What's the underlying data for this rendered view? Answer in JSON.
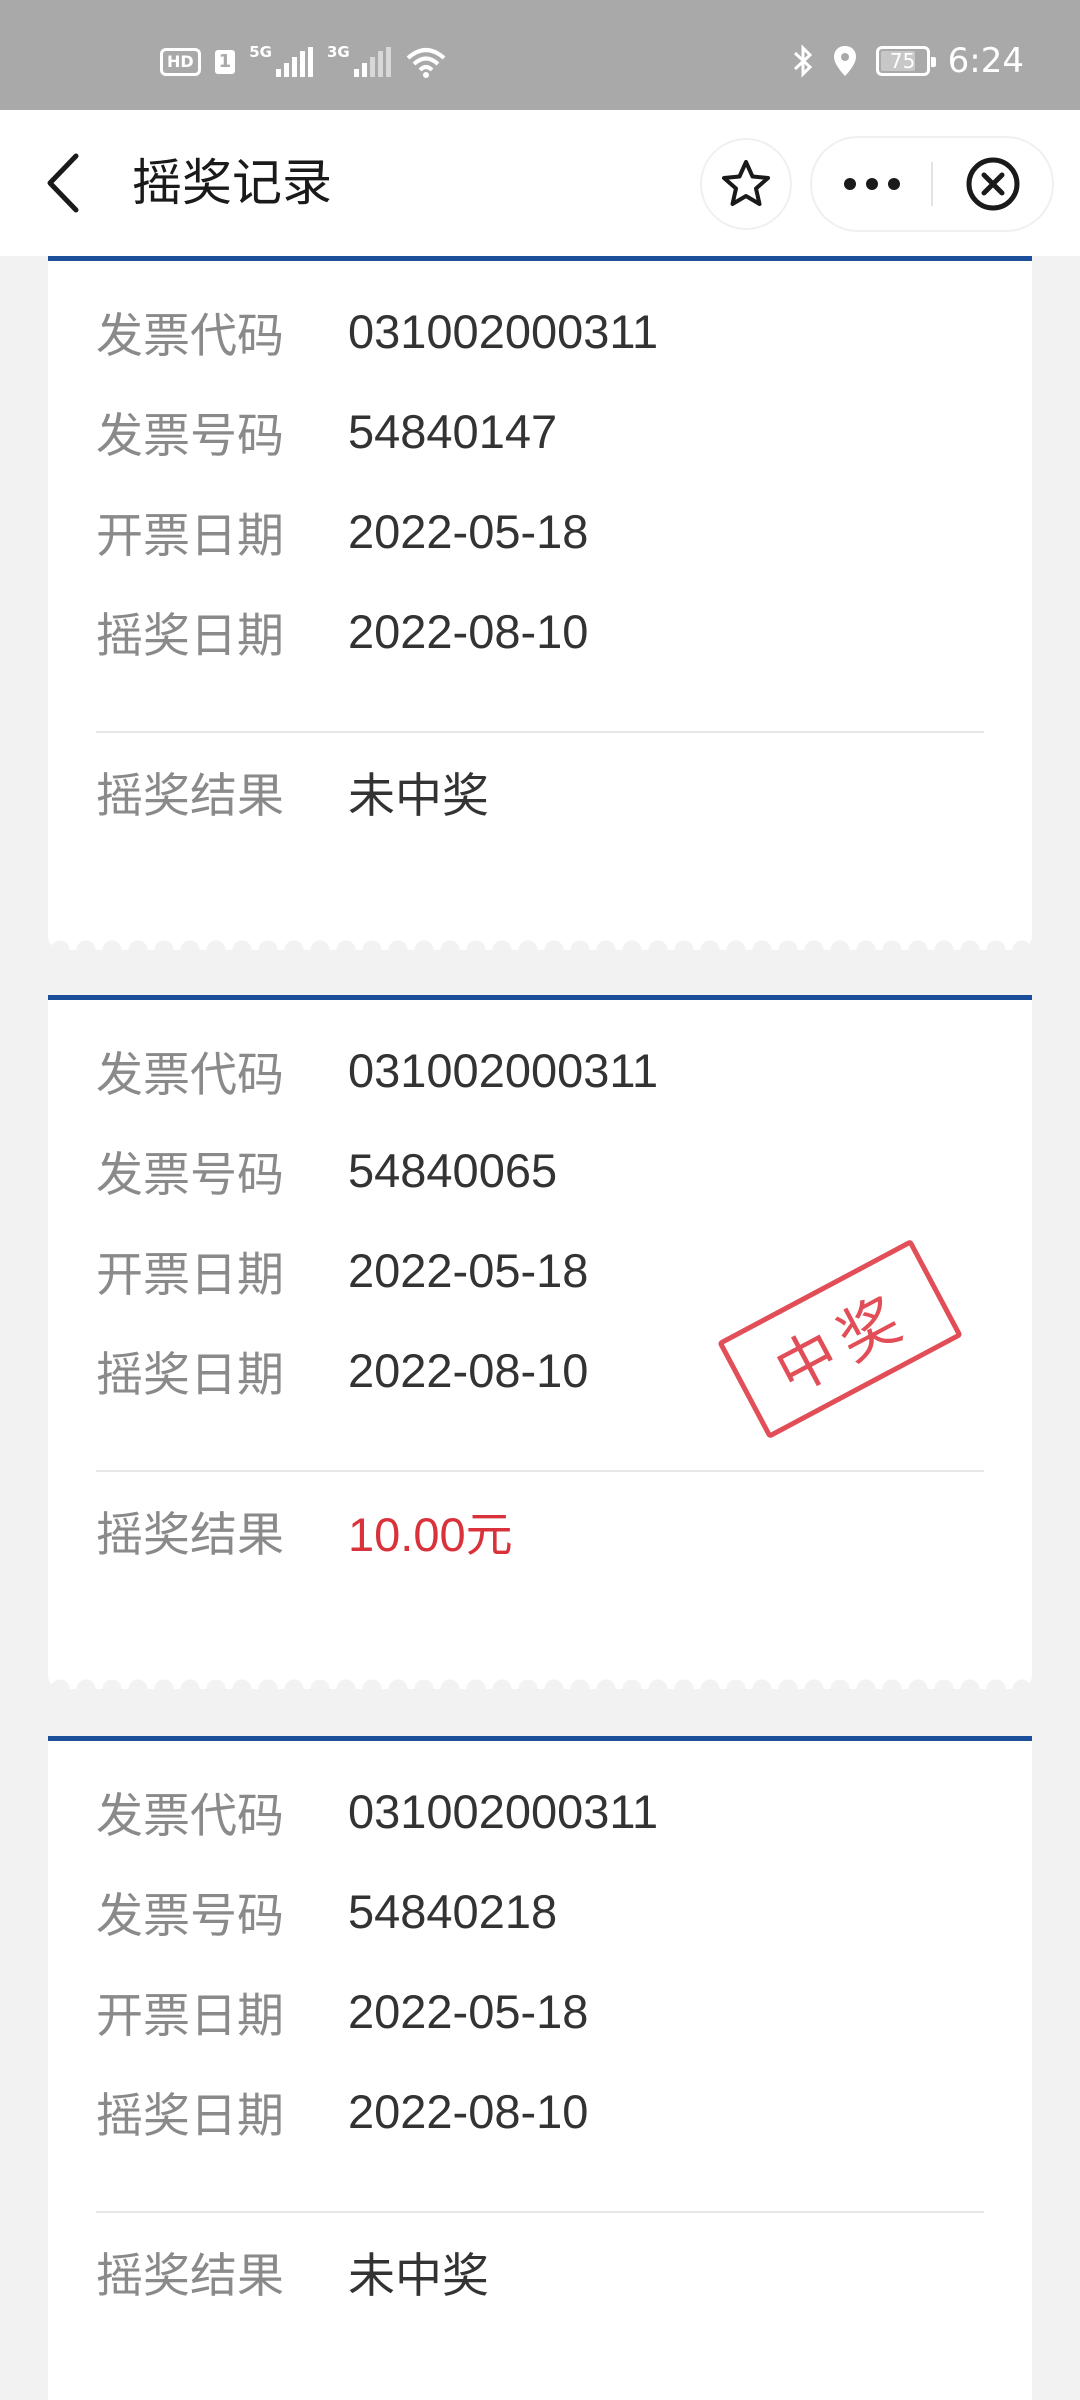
{
  "status_bar": {
    "hd_label": "HD",
    "sim_label": "1",
    "net1_label": "5G",
    "net2_label": "3G",
    "battery_level": "75",
    "time": "6:24"
  },
  "nav": {
    "title": "摇奖记录"
  },
  "labels": {
    "invoice_code": "发票代码",
    "invoice_number": "发票号码",
    "issue_date": "开票日期",
    "draw_date": "摇奖日期",
    "draw_result": "摇奖结果"
  },
  "records": [
    {
      "invoice_code": "031002000311",
      "invoice_number": "54840147",
      "issue_date": "2022-05-18",
      "draw_date": "2022-08-10",
      "result": "未中奖"
    },
    {
      "invoice_code": "031002000311",
      "invoice_number": "54840065",
      "issue_date": "2022-05-18",
      "draw_date": "2022-08-10",
      "result": "10.00元",
      "stamp": "中奖"
    },
    {
      "invoice_code": "031002000311",
      "invoice_number": "54840218",
      "issue_date": "2022-05-18",
      "draw_date": "2022-08-10",
      "result": "未中奖"
    }
  ],
  "colors": {
    "accent_border": "#1b4f9b",
    "win_text": "#d9323a",
    "stamp": "#e0404a"
  }
}
